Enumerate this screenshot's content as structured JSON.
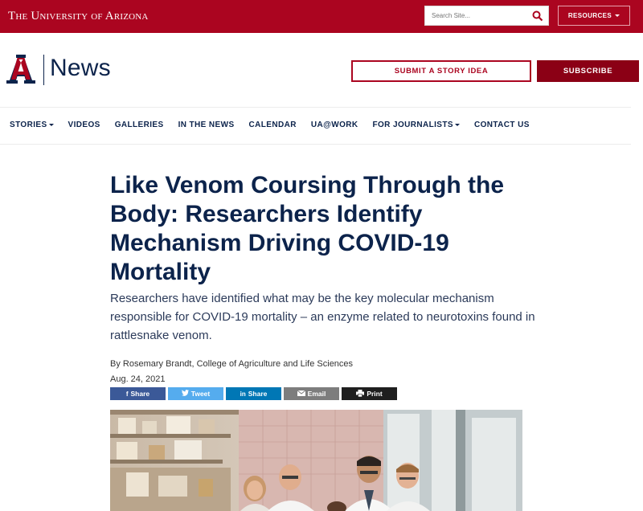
{
  "topbar": {
    "wordmark": "The University of Arizona",
    "search_placeholder": "Search Site...",
    "resources_label": "RESOURCES"
  },
  "header": {
    "site_title": "News",
    "submit_label": "SUBMIT A STORY IDEA",
    "subscribe_label": "SUBSCRIBE"
  },
  "nav": {
    "items": [
      {
        "label": "STORIES",
        "dropdown": true
      },
      {
        "label": "VIDEOS"
      },
      {
        "label": "GALLERIES"
      },
      {
        "label": "IN THE NEWS"
      },
      {
        "label": "CALENDAR"
      },
      {
        "label": "UA@WORK"
      },
      {
        "label": "FOR JOURNALISTS",
        "dropdown": true
      },
      {
        "label": "CONTACT US"
      }
    ]
  },
  "article": {
    "headline": "Like Venom Coursing Through the Body: Researchers Identify Mechanism Driving COVID-19 Mortality",
    "summary": "Researchers have identified what may be the key molecular mechanism responsible for COVID-19 mortality – an enzyme related to neurotoxins found in rattlesnake venom.",
    "byline": "By Rosemary Brandt, College of Agriculture and Life Sciences",
    "date": "Aug. 24, 2021"
  },
  "share": {
    "facebook": "Share",
    "twitter": "Tweet",
    "linkedin": "Share",
    "email": "Email",
    "print": "Print"
  },
  "colors": {
    "brand_red": "#ab0520",
    "brand_navy": "#0c234b",
    "subscribe_red": "#8b0015"
  }
}
